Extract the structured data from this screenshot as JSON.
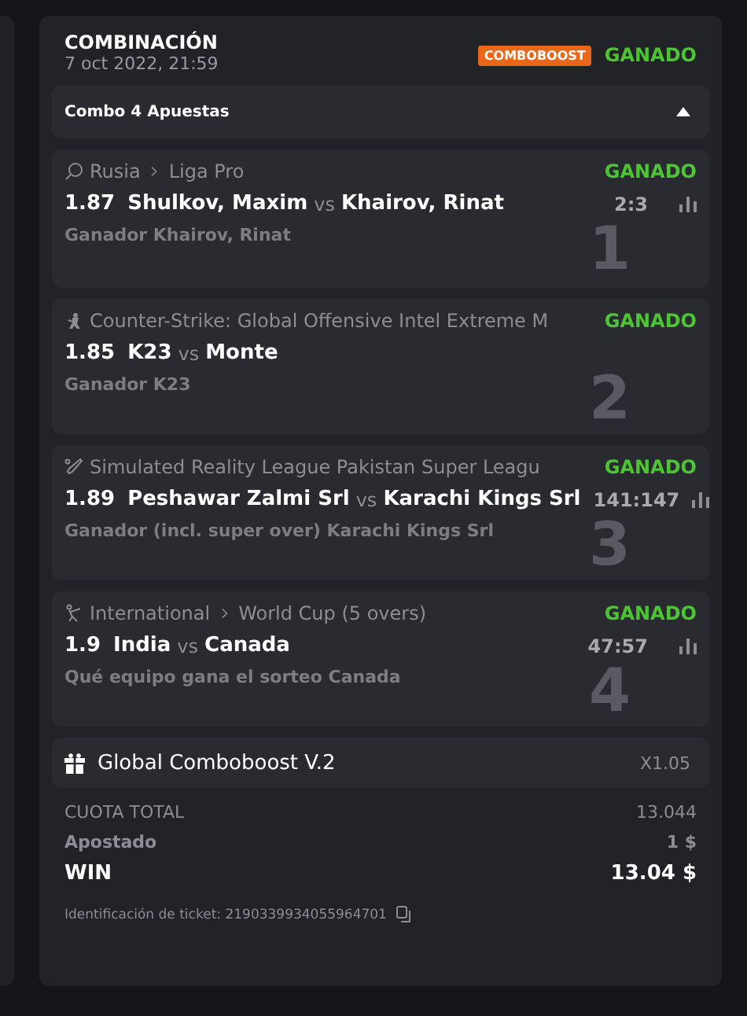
{
  "header": {
    "title": "COMBINACIÓN",
    "date": "7 oct 2022, 21:59",
    "badge": "COMBOBOOST",
    "status": "GANADO"
  },
  "combo": {
    "label": "Combo 4 Apuestas",
    "expanded": true
  },
  "bets": [
    {
      "kind": "paddle",
      "league": [
        "Rusia",
        "Liga Pro"
      ],
      "status": "GANADO",
      "odds": "1.87",
      "team1": "Shulkov, Maxim",
      "vs": "vs",
      "team2": "Khairov, Rinat",
      "score": "2:3",
      "stats": true,
      "market": "Ganador Khairov, Rinat",
      "number": "1"
    },
    {
      "kind": "soldier",
      "league": [
        "Counter-Strike: Global Offensive Intel Extreme M"
      ],
      "status": "GANADO",
      "odds": "1.85",
      "team1": "K23",
      "vs": "vs",
      "team2": "Monte",
      "stats": false,
      "market": "Ganador K23",
      "number": "2"
    },
    {
      "kind": "bat",
      "league": [
        "Simulated Reality League Pakistan Super Leagu"
      ],
      "status": "GANADO",
      "odds": "1.89",
      "team1": "Peshawar Zalmi Srl",
      "vs": "vs",
      "team2": "Karachi Kings Srl",
      "score": "141:147",
      "stats": true,
      "market": "Ganador (incl. super over) Karachi Kings Srl",
      "number": "3"
    },
    {
      "kind": "batsman",
      "league": [
        "International",
        "World Cup (5 overs)"
      ],
      "status": "GANADO",
      "odds": "1.9",
      "team1": "India",
      "vs": "vs",
      "team2": "Canada",
      "score": "47:57",
      "stats": true,
      "market": "Qué equipo gana el sorteo Canada",
      "number": "4"
    }
  ],
  "boost": {
    "label": "Global Comboboost V.2",
    "value": "X1.05"
  },
  "totals": [
    {
      "kind": "caps",
      "label": "CUOTA TOTAL",
      "value": "13.044"
    },
    {
      "kind": "plain",
      "label": "Apostado",
      "value": "1 $"
    },
    {
      "kind": "strong",
      "label": "WIN",
      "value": "13.04 $"
    }
  ],
  "ticket": "Identificación de ticket: 2190339934055964701"
}
